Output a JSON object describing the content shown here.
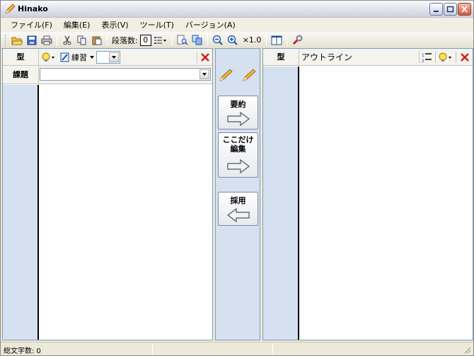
{
  "window": {
    "title": "Hinako"
  },
  "menu": [
    "ファイル(F)",
    "編集(E)",
    "表示(V)",
    "ツール(T)",
    "バージョン(A)"
  ],
  "toolbar": {
    "paragraph_label": "段落数:",
    "paragraph_value": "0",
    "zoom_label": "×1.0"
  },
  "left_panel": {
    "type_header": "型",
    "practice_label": "練習",
    "topic_label": "課題",
    "topic_value": ""
  },
  "middle_panel": {
    "summarize_label": "要約",
    "edit_here_label_line1": "ここだけ",
    "edit_here_label_line2": "編集",
    "adopt_label": "採用"
  },
  "right_panel": {
    "type_header": "型",
    "outline_header": "アウトライン"
  },
  "statusbar": {
    "char_count_text": "総文字数: 0"
  },
  "colors": {
    "side_column": "#d5e0f0",
    "close_red": "#d02020",
    "pencil": "#e0a030"
  }
}
